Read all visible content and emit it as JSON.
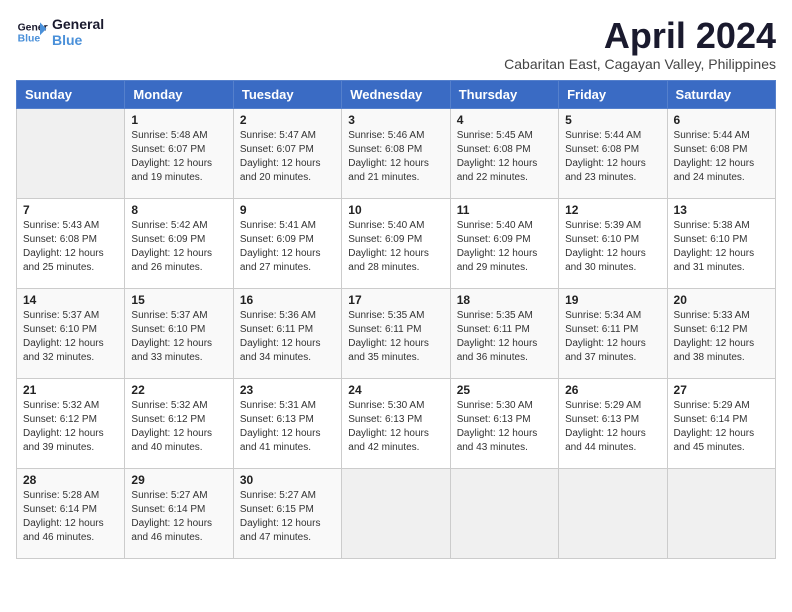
{
  "logo": {
    "line1": "General",
    "line2": "Blue"
  },
  "title": "April 2024",
  "subtitle": "Cabaritan East, Cagayan Valley, Philippines",
  "weekdays": [
    "Sunday",
    "Monday",
    "Tuesday",
    "Wednesday",
    "Thursday",
    "Friday",
    "Saturday"
  ],
  "weeks": [
    [
      {
        "day": "",
        "info": ""
      },
      {
        "day": "1",
        "info": "Sunrise: 5:48 AM\nSunset: 6:07 PM\nDaylight: 12 hours\nand 19 minutes."
      },
      {
        "day": "2",
        "info": "Sunrise: 5:47 AM\nSunset: 6:07 PM\nDaylight: 12 hours\nand 20 minutes."
      },
      {
        "day": "3",
        "info": "Sunrise: 5:46 AM\nSunset: 6:08 PM\nDaylight: 12 hours\nand 21 minutes."
      },
      {
        "day": "4",
        "info": "Sunrise: 5:45 AM\nSunset: 6:08 PM\nDaylight: 12 hours\nand 22 minutes."
      },
      {
        "day": "5",
        "info": "Sunrise: 5:44 AM\nSunset: 6:08 PM\nDaylight: 12 hours\nand 23 minutes."
      },
      {
        "day": "6",
        "info": "Sunrise: 5:44 AM\nSunset: 6:08 PM\nDaylight: 12 hours\nand 24 minutes."
      }
    ],
    [
      {
        "day": "7",
        "info": "Sunrise: 5:43 AM\nSunset: 6:08 PM\nDaylight: 12 hours\nand 25 minutes."
      },
      {
        "day": "8",
        "info": "Sunrise: 5:42 AM\nSunset: 6:09 PM\nDaylight: 12 hours\nand 26 minutes."
      },
      {
        "day": "9",
        "info": "Sunrise: 5:41 AM\nSunset: 6:09 PM\nDaylight: 12 hours\nand 27 minutes."
      },
      {
        "day": "10",
        "info": "Sunrise: 5:40 AM\nSunset: 6:09 PM\nDaylight: 12 hours\nand 28 minutes."
      },
      {
        "day": "11",
        "info": "Sunrise: 5:40 AM\nSunset: 6:09 PM\nDaylight: 12 hours\nand 29 minutes."
      },
      {
        "day": "12",
        "info": "Sunrise: 5:39 AM\nSunset: 6:10 PM\nDaylight: 12 hours\nand 30 minutes."
      },
      {
        "day": "13",
        "info": "Sunrise: 5:38 AM\nSunset: 6:10 PM\nDaylight: 12 hours\nand 31 minutes."
      }
    ],
    [
      {
        "day": "14",
        "info": "Sunrise: 5:37 AM\nSunset: 6:10 PM\nDaylight: 12 hours\nand 32 minutes."
      },
      {
        "day": "15",
        "info": "Sunrise: 5:37 AM\nSunset: 6:10 PM\nDaylight: 12 hours\nand 33 minutes."
      },
      {
        "day": "16",
        "info": "Sunrise: 5:36 AM\nSunset: 6:11 PM\nDaylight: 12 hours\nand 34 minutes."
      },
      {
        "day": "17",
        "info": "Sunrise: 5:35 AM\nSunset: 6:11 PM\nDaylight: 12 hours\nand 35 minutes."
      },
      {
        "day": "18",
        "info": "Sunrise: 5:35 AM\nSunset: 6:11 PM\nDaylight: 12 hours\nand 36 minutes."
      },
      {
        "day": "19",
        "info": "Sunrise: 5:34 AM\nSunset: 6:11 PM\nDaylight: 12 hours\nand 37 minutes."
      },
      {
        "day": "20",
        "info": "Sunrise: 5:33 AM\nSunset: 6:12 PM\nDaylight: 12 hours\nand 38 minutes."
      }
    ],
    [
      {
        "day": "21",
        "info": "Sunrise: 5:32 AM\nSunset: 6:12 PM\nDaylight: 12 hours\nand 39 minutes."
      },
      {
        "day": "22",
        "info": "Sunrise: 5:32 AM\nSunset: 6:12 PM\nDaylight: 12 hours\nand 40 minutes."
      },
      {
        "day": "23",
        "info": "Sunrise: 5:31 AM\nSunset: 6:13 PM\nDaylight: 12 hours\nand 41 minutes."
      },
      {
        "day": "24",
        "info": "Sunrise: 5:30 AM\nSunset: 6:13 PM\nDaylight: 12 hours\nand 42 minutes."
      },
      {
        "day": "25",
        "info": "Sunrise: 5:30 AM\nSunset: 6:13 PM\nDaylight: 12 hours\nand 43 minutes."
      },
      {
        "day": "26",
        "info": "Sunrise: 5:29 AM\nSunset: 6:13 PM\nDaylight: 12 hours\nand 44 minutes."
      },
      {
        "day": "27",
        "info": "Sunrise: 5:29 AM\nSunset: 6:14 PM\nDaylight: 12 hours\nand 45 minutes."
      }
    ],
    [
      {
        "day": "28",
        "info": "Sunrise: 5:28 AM\nSunset: 6:14 PM\nDaylight: 12 hours\nand 46 minutes."
      },
      {
        "day": "29",
        "info": "Sunrise: 5:27 AM\nSunset: 6:14 PM\nDaylight: 12 hours\nand 46 minutes."
      },
      {
        "day": "30",
        "info": "Sunrise: 5:27 AM\nSunset: 6:15 PM\nDaylight: 12 hours\nand 47 minutes."
      },
      {
        "day": "",
        "info": ""
      },
      {
        "day": "",
        "info": ""
      },
      {
        "day": "",
        "info": ""
      },
      {
        "day": "",
        "info": ""
      }
    ]
  ]
}
